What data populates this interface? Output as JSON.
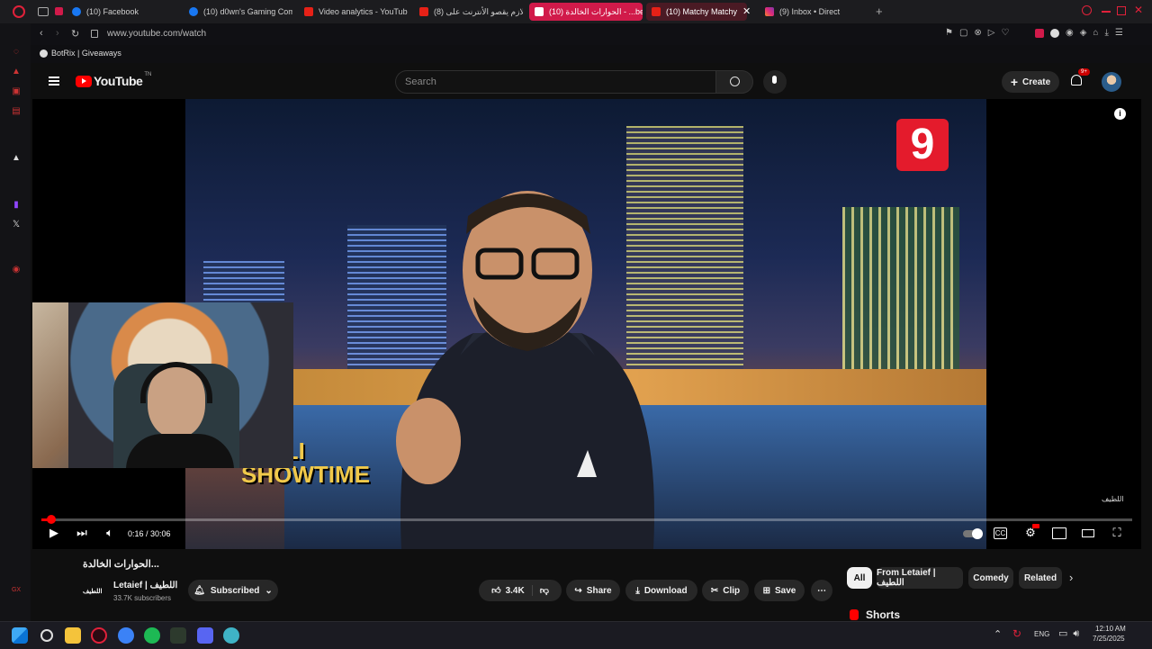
{
  "browser": {
    "tabs": [
      {
        "label": "(10) Facebook",
        "icon": "facebook-icon"
      },
      {
        "label": "(10) d0wn's Gaming Com",
        "icon": "facebook-icon"
      },
      {
        "label": "Video analytics - YouTub",
        "icon": "youtube-icon"
      },
      {
        "label": "لازم يقصو الأنترنت على (8)",
        "icon": "youtube-icon"
      },
      {
        "label": "(10) الحوارات الخالدة - ...be",
        "icon": "youtube-icon"
      },
      {
        "label": "(10) Matchy Matchy",
        "icon": "youtube-icon"
      },
      {
        "label": "(9) Inbox • Direct",
        "icon": "instagram-icon"
      }
    ],
    "url": "www.youtube.com/watch",
    "bookmark": "BotRix | Giveaways"
  },
  "youtube": {
    "logo_text": "YouTube",
    "logo_sup": "TN",
    "search_placeholder": "Search",
    "create_label": "Create",
    "notif_count": "9+"
  },
  "video": {
    "channel_badge": "9",
    "lower_third_1": "JELLI",
    "lower_third_2": "SHOWTIME",
    "watermark": "اللطيف",
    "time": "0:16 / 30:06",
    "progress_fraction": 0.009
  },
  "meta": {
    "title": "الحوارات الخالدة...",
    "channel_name": "Letaief | اللطيف",
    "channel_avatar_text": "اللطيف",
    "subscribers": "33.7K subscribers",
    "subscribed_label": "Subscribed",
    "likes": "3.4K",
    "share_label": "Share",
    "download_label": "Download",
    "clip_label": "Clip",
    "save_label": "Save"
  },
  "chips": [
    "All",
    "From Letaief | اللطيف",
    "Comedy",
    "Related"
  ],
  "shorts_label": "Shorts",
  "taskbar": {
    "lang": "ENG",
    "time": "12:10 AM",
    "date": "7/25/2025"
  }
}
